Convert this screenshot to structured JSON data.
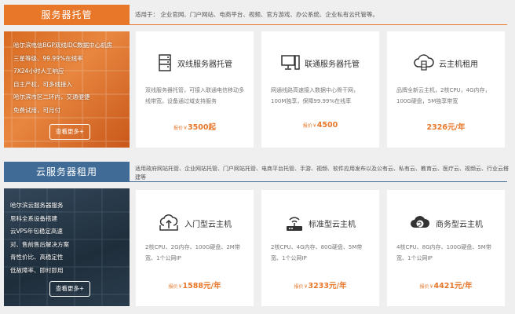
{
  "colors": {
    "orange": "#e8772a",
    "blue": "#3f6b96",
    "price": "#e8772a"
  },
  "hosting": {
    "tab": "服务器托管",
    "applies": "适用于：  企业官网、门户网站、电商平台、视频、官方游戏、办公系统、企业私有云托管等。",
    "left_lines": [
      "哈尔滨电信BGP双线IDC数据中心机房",
      "三星等级、99.99%在线率",
      "7X24小时人工响应",
      "自主产权，可多线接入",
      "哈尔滨市区二环内，交通便捷",
      "免费试用，可月付"
    ],
    "more": "查看更多+",
    "cards": [
      {
        "icon": "server-rack-icon",
        "title": "双线服务器托管",
        "desc": "双线服务器托管，可接入联通电信移动多线带宽，设备通过域支持服务",
        "price_label": "报价￥",
        "price": "3500起"
      },
      {
        "icon": "desktop-computer-icon",
        "title": "联通服务器托管",
        "desc": "网通线路高速接入数据中心骨干网，100M独享，保障99.99%在线率",
        "price_label": "报价￥",
        "price": "4500"
      },
      {
        "icon": "cloud-server-icon",
        "title": "云主机租用",
        "desc": "品牌全新云主机，2核CPU，4G内存，100G硬盘，5M独享带宽",
        "price_label": "",
        "price": "2326元/年"
      }
    ]
  },
  "cloud": {
    "tab": "云服务器租用",
    "applies": "适用政府网站托管、企业网站托管、门户网站托管、电商平台托管、手游、视频、软件应用发布以及公有云、私有云、教育云、医疗云、视频云、行业云搭建等",
    "left_lines": [
      "哈尔滨云服务器服务",
      "思科全系设备搭建",
      "云VPS年包稳定高速",
      "    对、售前售后解决方案",
      "青性价比、高稳定性",
      "低故障率、即时即用"
    ],
    "more": "查看更多+",
    "cards": [
      {
        "icon": "cloud-upload-icon",
        "title": "入门型云主机",
        "desc": "2核CPU、2G内存、100G硬盘、2M带宽、1个公网IP",
        "price_label": "报价￥",
        "price": "1588元/年"
      },
      {
        "icon": "router-icon",
        "title": "标准型云主机",
        "desc": "2核CPU、4G内存、80G硬盘、5M带宽、1个公网IP",
        "price_label": "报价￥",
        "price": "3233元/年"
      },
      {
        "icon": "cloud-globe-icon",
        "title": "商务型云主机",
        "desc": "4核CPU、8G内存、100G硬盘、5M带宽、1个公网IP",
        "price_label": "报价￥",
        "price": "4421元/年"
      }
    ]
  }
}
